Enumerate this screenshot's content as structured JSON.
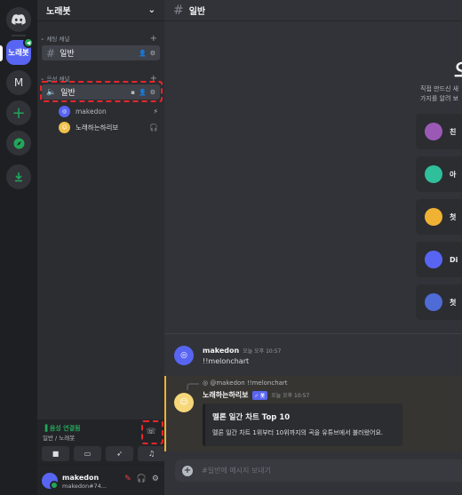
{
  "server": {
    "name": "노래봇"
  },
  "guilds": {
    "home_icon": "discord-icon",
    "active_label": "노래봇",
    "m_label": "M",
    "add_icon": "plus-icon",
    "explore_icon": "compass-icon",
    "download_icon": "download-icon"
  },
  "categories": {
    "text": "채팅 채널",
    "voice": "음성 채널"
  },
  "text_channel": {
    "name": "일반"
  },
  "voice_channel": {
    "name": "일반"
  },
  "voice_users": [
    {
      "name": "makedon"
    },
    {
      "name": "노래하는하리보"
    }
  ],
  "voice_panel": {
    "status": "음성 연결됨",
    "sub": "일반 / 노래봇"
  },
  "user_panel": {
    "name": "makedon",
    "tag": "makedon#74..."
  },
  "main": {
    "channel_title": "일반",
    "welcome_title": "오",
    "welcome_sub_1": "직접 만드신 새",
    "welcome_sub_2": "가지를 알려  보",
    "cards": [
      {
        "label": "친",
        "icon": "invite-icon",
        "color": "#9b59b6"
      },
      {
        "label": "아",
        "icon": "avatar-icon",
        "color": "#2fbf9b"
      },
      {
        "label": "첫",
        "icon": "message-icon",
        "color": "#f0b232"
      },
      {
        "label": "Di",
        "icon": "app-icon",
        "color": "#5865f2"
      },
      {
        "label": "첫",
        "icon": "bot-icon",
        "color": "#4e6bd6"
      }
    ]
  },
  "messages": [
    {
      "author": "makedon",
      "time": "오늘 오후 10:57",
      "text": "!!melonchart"
    },
    {
      "reply": "@makedon !!melonchart",
      "author": "노래하는하리보",
      "bot_tag": "✓ 봇",
      "time": "오늘 오후 10:57",
      "embed_title": "멜론 일간 차트 Top 10",
      "embed_desc": "멜론 일간 차트 1위부터 10위까지의 곡을 유튜브에서 불러왔어요."
    }
  ],
  "composer": {
    "placeholder": "#일반에 메시지 보내기"
  }
}
